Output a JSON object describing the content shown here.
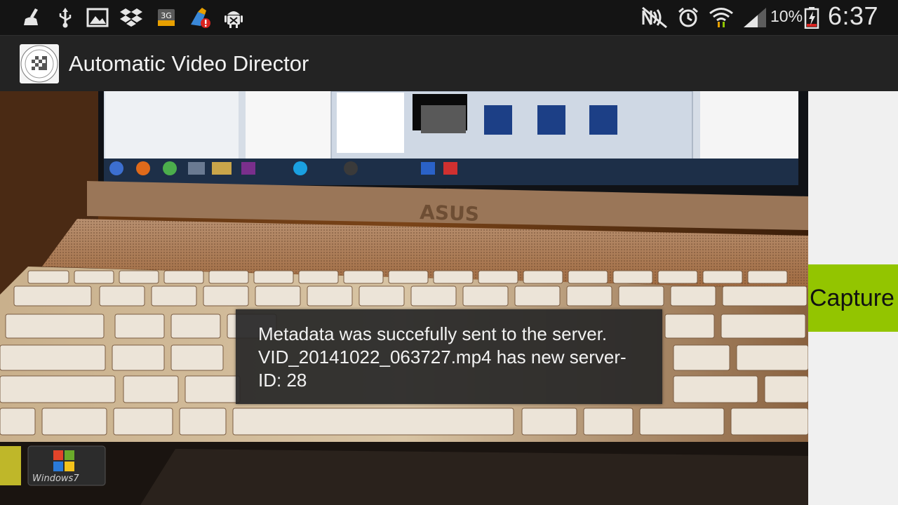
{
  "status_bar": {
    "left_icons": [
      "broom-icon",
      "usb-icon",
      "image-icon",
      "dropbox-icon",
      "3g-icon",
      "cleaner-alert-icon",
      "android-debug-icon"
    ],
    "right_icons": [
      "nfc-off-icon",
      "alarm-icon",
      "wifi-icon",
      "signal-icon",
      "battery-charging-icon"
    ],
    "network_label": "3G",
    "battery_percent": "10%",
    "time": "6:37"
  },
  "action_bar": {
    "title": "Automatic Video Director"
  },
  "side_panel": {
    "capture_label": "Capture",
    "capture_color": "#93c500"
  },
  "toast": {
    "message": "Metadata was succefully sent to the server. VID_20141022_063727.mp4 has new server-ID: 28"
  },
  "camera_preview": {
    "laptop_brand": "ASUS",
    "os_badge": "Windows7"
  }
}
